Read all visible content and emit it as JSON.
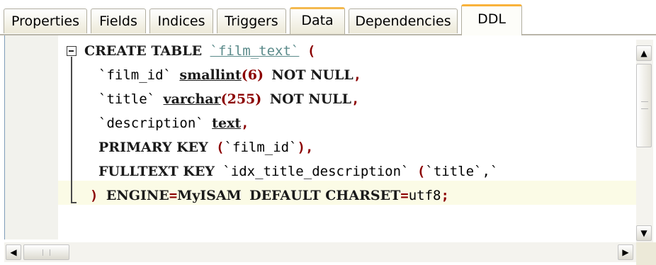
{
  "tabs": [
    {
      "label": "Properties"
    },
    {
      "label": "Fields"
    },
    {
      "label": "Indices"
    },
    {
      "label": "Triggers"
    },
    {
      "label": "Data"
    },
    {
      "label": "Dependencies"
    },
    {
      "label": "DDL"
    }
  ],
  "active_tab": "DDL",
  "ddl": {
    "l1_kw": "CREATE TABLE",
    "l1_name": "`film_text`",
    "l1_paren": "(",
    "l2_col": "`film_id`",
    "l2_type": "smallint",
    "l2_size": "(6)",
    "l2_nn": "NOT NULL",
    "l2_comma": ",",
    "l3_col": "`title`",
    "l3_type": "varchar",
    "l3_size": "(255)",
    "l3_nn": "NOT NULL",
    "l3_comma": ",",
    "l4_col": "`description`",
    "l4_type": "text",
    "l4_comma": ",",
    "l5_kw": "PRIMARY KEY",
    "l5_open": "(",
    "l5_col": "`film_id`",
    "l5_close": "),",
    "l6_kw": "FULLTEXT KEY",
    "l6_name": "`idx_title_description`",
    "l6_open": "(",
    "l6_col": "`title`,`",
    "l7_close": ")",
    "l7_kw1": "ENGINE",
    "l7_eq1": "=",
    "l7_val1": "MyISAM",
    "l7_kw2": "DEFAULT CHARSET",
    "l7_eq2": "=",
    "l7_val2": "utf8",
    "l7_semi": ";"
  },
  "scroll": {
    "up": "▲",
    "down": "▼",
    "left": "◀",
    "right": "▶"
  },
  "colors": {
    "active_tab_accent": "#f9b23a",
    "current_line": "#fbfbe6",
    "punctuation": "#8b0000",
    "string": "#5a8a8a"
  }
}
